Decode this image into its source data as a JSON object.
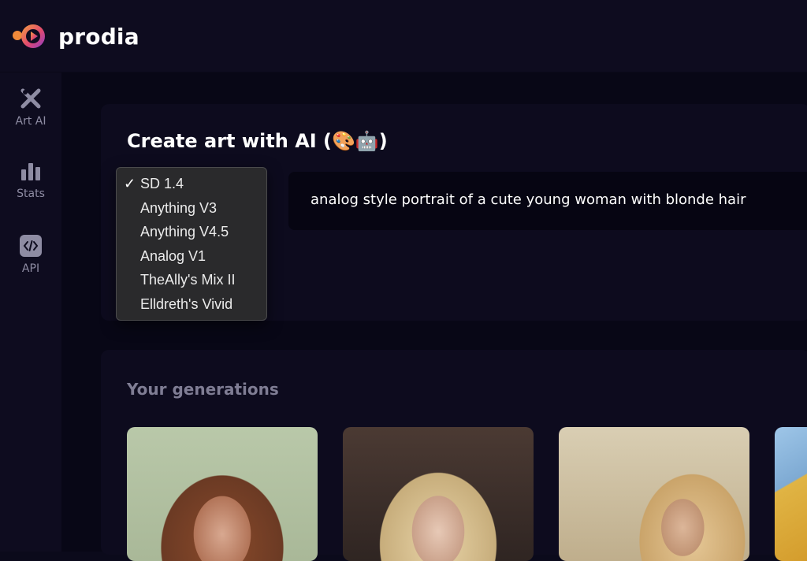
{
  "brand": {
    "name": "prodia",
    "colors": {
      "gradient_start": "#f4a040",
      "gradient_mid": "#e14a6e",
      "gradient_end": "#8a3cc9"
    }
  },
  "sidebar": {
    "items": [
      {
        "label": "Art AI",
        "icon": "art-ai-icon"
      },
      {
        "label": "Stats",
        "icon": "bar-chart-icon"
      },
      {
        "label": "API",
        "icon": "code-icon"
      }
    ]
  },
  "create": {
    "title": "Create art with AI (🎨🤖)",
    "prompt": "analog style portrait of a cute young woman with blonde hair"
  },
  "model_dropdown": {
    "selected": "SD 1.4",
    "check": "✓",
    "options": [
      "SD 1.4",
      "Anything V3",
      "Anything V4.5",
      "Analog V1",
      "TheAlly's Mix II",
      "Elldreth's Vivid"
    ]
  },
  "generations": {
    "title": "Your generations",
    "images": [
      {
        "icon": "portrait-image"
      },
      {
        "icon": "portrait-image"
      },
      {
        "icon": "portrait-image"
      },
      {
        "icon": "portrait-image"
      }
    ]
  }
}
